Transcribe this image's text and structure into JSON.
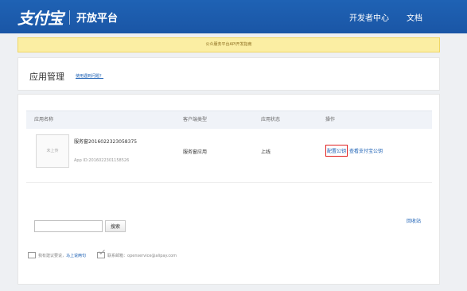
{
  "header": {
    "logo_text": "支付宝",
    "platform_name": "开放平台",
    "nav": [
      "开发者中心",
      "文档"
    ]
  },
  "notice": "公众服务平台API开发指南",
  "page": {
    "title": "应用管理",
    "help_link": "使用遇到问题？"
  },
  "table": {
    "headers": [
      "应用名称",
      "客户端类型",
      "应用状态",
      "操作"
    ],
    "rows": [
      {
        "thumb_placeholder": "未上传",
        "name": "服务窗2016022323058375",
        "app_id": "App ID:2016022301158526",
        "client_type": "服务窗应用",
        "status": "上线",
        "ops": [
          "配置公钥",
          "查看支付宝公钥"
        ]
      }
    ]
  },
  "search": {
    "value": "",
    "button": "搜索"
  },
  "recycle_link": "回收站",
  "footer": {
    "feedback_text": "我有建议要说，",
    "feedback_link": "马上说两句",
    "contact_text": "联系邮箱：openservice@alipay.com"
  },
  "colors": {
    "header_bg": "#1f62b4",
    "link": "#1a5fb4",
    "notice_bg": "#fbeea3",
    "highlight_border": "#e02020"
  }
}
